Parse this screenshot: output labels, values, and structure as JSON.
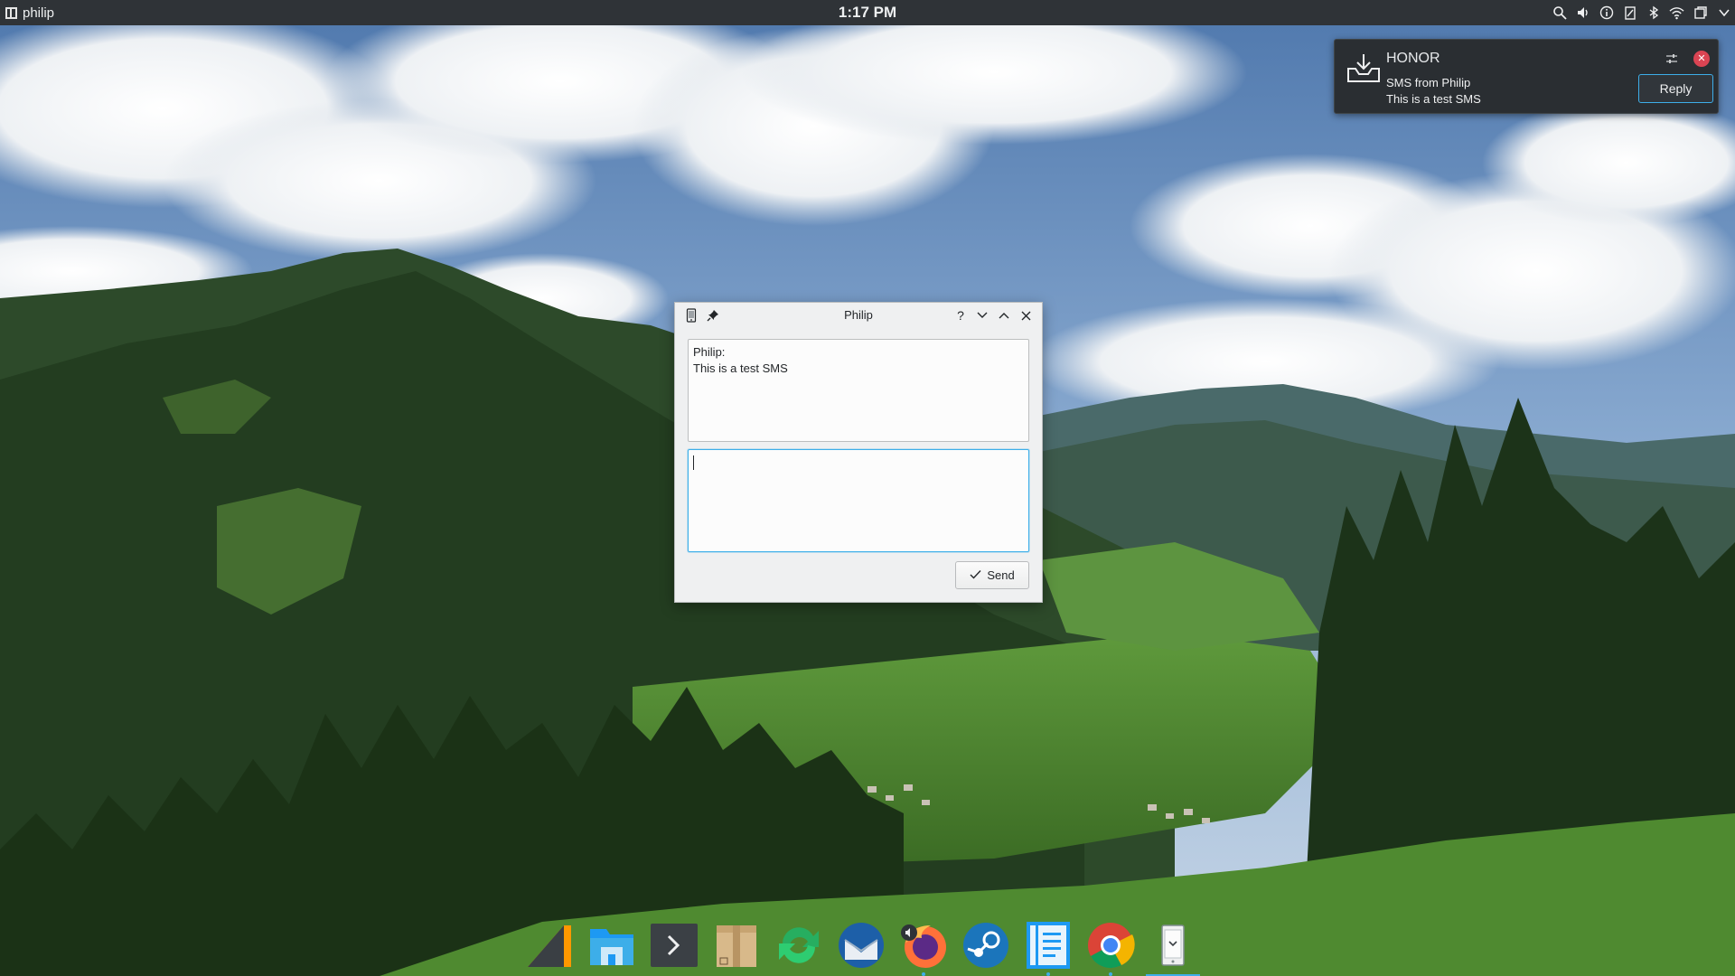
{
  "panel": {
    "active_app": "philip",
    "clock": "1:17 PM",
    "tray_icons": [
      "search-icon",
      "volume-icon",
      "info-icon",
      "clipboard-icon",
      "bluetooth-icon",
      "wifi-icon",
      "window-icon",
      "chevron-down-icon"
    ]
  },
  "notification": {
    "app_name": "HONOR",
    "title": "SMS from Philip",
    "body": "This is a test SMS",
    "reply_label": "Reply",
    "icon": "download-tray-icon",
    "colors": {
      "background": "#2a2e32",
      "accent": "#3daee9",
      "close": "#da4453"
    }
  },
  "dialog": {
    "title": "Philip",
    "received_sender": "Philip:",
    "received_text": "This is a test SMS",
    "reply_value": "",
    "send_label": "Send",
    "titlebar_buttons": [
      "help-icon",
      "minimize-icon",
      "maximize-icon",
      "close-icon"
    ]
  },
  "dock": {
    "items": [
      {
        "name": "sublime-text-icon",
        "running": false
      },
      {
        "name": "file-manager-icon",
        "running": false
      },
      {
        "name": "terminal-icon",
        "running": false
      },
      {
        "name": "archive-manager-icon",
        "running": false
      },
      {
        "name": "sync-icon",
        "running": false
      },
      {
        "name": "thunderbird-icon",
        "running": false
      },
      {
        "name": "firefox-icon",
        "running": true
      },
      {
        "name": "steam-icon",
        "running": false
      },
      {
        "name": "text-editor-icon",
        "running": true
      },
      {
        "name": "chrome-icon",
        "running": true
      },
      {
        "name": "kdeconnect-icon",
        "running": true,
        "active": true
      }
    ]
  }
}
